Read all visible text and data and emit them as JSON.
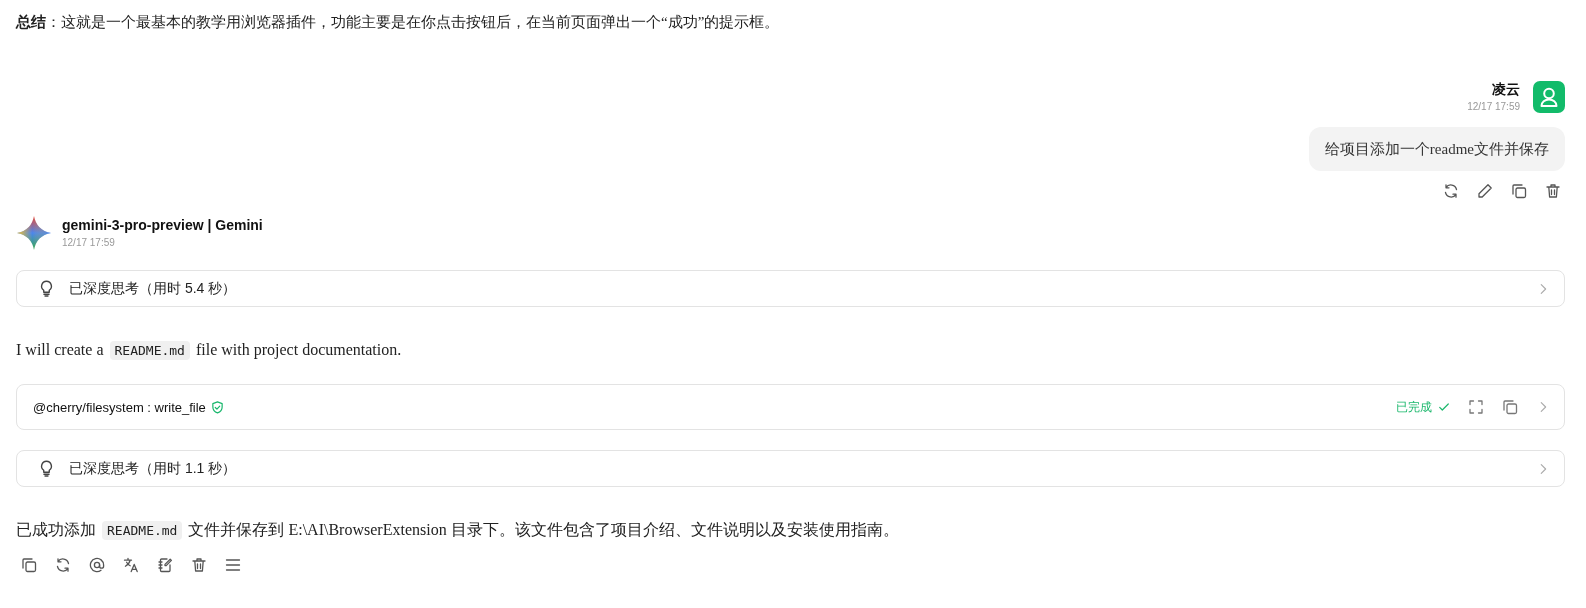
{
  "summary": {
    "text": "**总结**：这就是一个最基本的教学用浏览器插件，功能主要是在你点击按钮后，在当前页面弹出一个“成功”的提示框。"
  },
  "user_message": {
    "name": "凌云",
    "time": "12/17 17:59",
    "text": "给项目添加一个readme文件并保存"
  },
  "assistant_message": {
    "model": "gemini-3-pro-preview | Gemini",
    "time": "12/17 17:59",
    "blocks": [
      {
        "kind": "thinking",
        "label": "已深度思考（用时 5.4 秒）"
      },
      {
        "kind": "paragraph",
        "parts": [
          {
            "kind": "text",
            "text": "I will create a "
          },
          {
            "kind": "code",
            "text": "README.md"
          },
          {
            "kind": "text",
            "text": " file with project documentation."
          }
        ]
      },
      {
        "kind": "tool",
        "name": "@cherry/filesystem : write_file",
        "status": "已完成"
      },
      {
        "kind": "thinking",
        "label": "已深度思考（用时 1.1 秒）"
      },
      {
        "kind": "paragraph",
        "parts": [
          {
            "kind": "text",
            "text": "已成功添加 "
          },
          {
            "kind": "code",
            "text": "README.md"
          },
          {
            "kind": "text",
            "text": " 文件并保存到 E:\\AI\\BrowserExtension 目录下。该文件包含了项目介绍、文件说明以及安装使用指南。"
          }
        ]
      }
    ]
  }
}
